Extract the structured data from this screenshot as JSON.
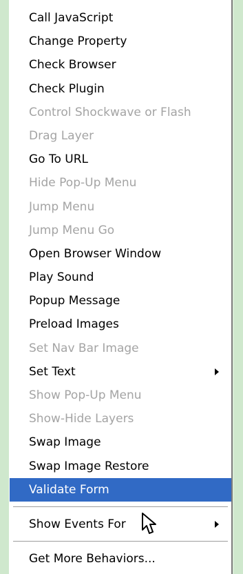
{
  "menu": {
    "items": [
      {
        "label": "Call JavaScript",
        "enabled": true
      },
      {
        "label": "Change Property",
        "enabled": true
      },
      {
        "label": "Check Browser",
        "enabled": true
      },
      {
        "label": "Check Plugin",
        "enabled": true
      },
      {
        "label": "Control Shockwave or Flash",
        "enabled": false
      },
      {
        "label": "Drag Layer",
        "enabled": false
      },
      {
        "label": "Go To URL",
        "enabled": true
      },
      {
        "label": "Hide Pop-Up Menu",
        "enabled": false
      },
      {
        "label": "Jump Menu",
        "enabled": false
      },
      {
        "label": "Jump Menu Go",
        "enabled": false
      },
      {
        "label": "Open Browser Window",
        "enabled": true
      },
      {
        "label": "Play Sound",
        "enabled": true
      },
      {
        "label": "Popup Message",
        "enabled": true
      },
      {
        "label": "Preload Images",
        "enabled": true
      },
      {
        "label": "Set Nav Bar Image",
        "enabled": false
      },
      {
        "label": "Set Text",
        "enabled": true,
        "submenu": true
      },
      {
        "label": "Show Pop-Up Menu",
        "enabled": false
      },
      {
        "label": "Show-Hide Layers",
        "enabled": false
      },
      {
        "label": "Swap Image",
        "enabled": true
      },
      {
        "label": "Swap Image Restore",
        "enabled": true
      },
      {
        "label": "Validate Form",
        "enabled": true,
        "highlighted": true
      }
    ],
    "show_events_for": {
      "label": "Show Events For",
      "submenu": true
    },
    "get_more_behaviors": {
      "label": "Get More Behaviors..."
    }
  },
  "colors": {
    "highlight": "#316ac5",
    "disabled_text": "#a4a4a4",
    "background": "#d9ecd7"
  },
  "icons": {
    "cursor": "arrow-cursor-icon",
    "submenu": "submenu-arrow-icon"
  }
}
